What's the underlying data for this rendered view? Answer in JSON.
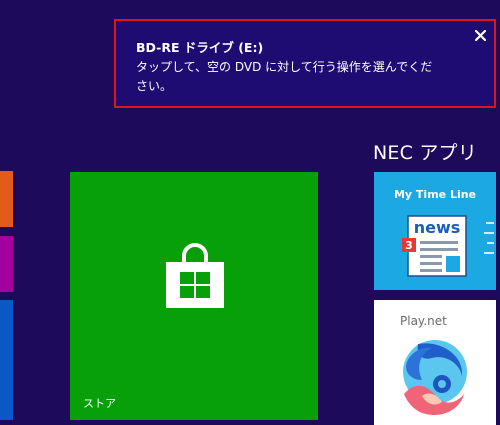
{
  "notification": {
    "title": "BD-RE ドライブ (E:)",
    "message": "タップして、空の DVD に対して行う操作を選んでください。",
    "close_label": "✕",
    "border_color": "#e0141e",
    "background_color": "#1f0c72"
  },
  "start_screen": {
    "background_color": "#1e0a5a",
    "group_title": "NEC アプリ",
    "tiles": {
      "store": {
        "label": "ストア",
        "icon": "shopping-bag-icon",
        "color": "#08a008"
      },
      "my_time_line": {
        "title": "My Time Line",
        "news_word": "news",
        "news_badge": "3",
        "color": "#1ca8e2"
      },
      "play_net": {
        "title": "Play.net",
        "color": "#ffffff"
      }
    },
    "edge_tile_colors": [
      "#e35a1c",
      "#a4009e",
      "#0a58c6"
    ]
  }
}
